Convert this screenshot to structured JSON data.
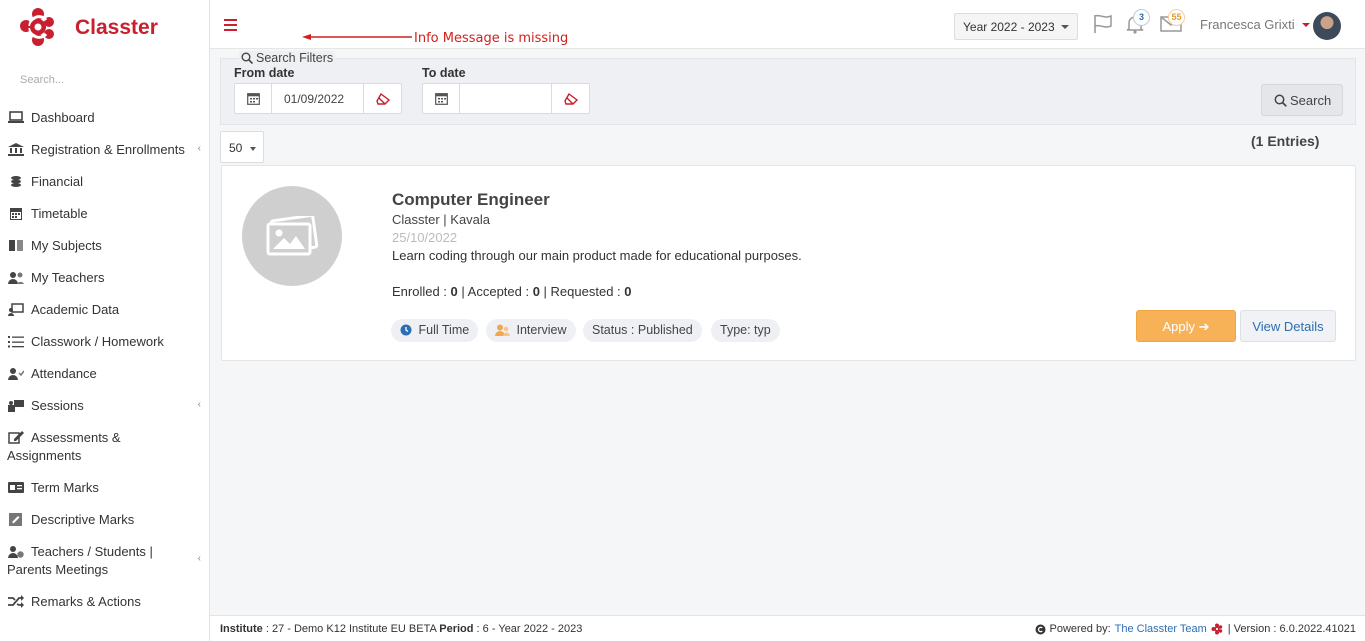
{
  "app": {
    "name": "Classter",
    "brand_color": "#c8202f"
  },
  "sidebar": {
    "search_placeholder": "Search...",
    "items": [
      {
        "label": "Dashboard",
        "icon": "laptop-icon"
      },
      {
        "label": "Registration & Enrollments",
        "icon": "bank-icon",
        "expandable": true
      },
      {
        "label": "Financial",
        "icon": "coins-icon"
      },
      {
        "label": "Timetable",
        "icon": "calendar-icon"
      },
      {
        "label": "My Subjects",
        "icon": "book-icon"
      },
      {
        "label": "My Teachers",
        "icon": "users-icon"
      },
      {
        "label": "Academic Data",
        "icon": "chalkboard-icon"
      },
      {
        "label": "Classwork / Homework",
        "icon": "tasks-icon"
      },
      {
        "label": "Attendance",
        "icon": "user-check-icon"
      },
      {
        "label": "Sessions",
        "icon": "sessions-icon",
        "expandable": true
      },
      {
        "label": "Assessments & Assignments",
        "icon": "edit-icon"
      },
      {
        "label": "Term Marks",
        "icon": "id-card-icon"
      },
      {
        "label": "Descriptive Marks",
        "icon": "note-icon"
      },
      {
        "label": "Teachers / Students | Parents Meetings",
        "icon": "meeting-icon",
        "expandable": true
      },
      {
        "label": "Remarks & Actions",
        "icon": "shuffle-icon"
      }
    ]
  },
  "header": {
    "annotation": "Info Message is missing",
    "year_selector": "Year 2022 - 2023",
    "notifications_count": "3",
    "messages_count": "55",
    "user_name": "Francesca Grixti"
  },
  "filters": {
    "legend": "Search Filters",
    "from_label": "From date",
    "from_value": "01/09/2022",
    "to_label": "To date",
    "to_value": "",
    "search_label": "Search"
  },
  "list": {
    "page_size": "50",
    "entries": "(1 Entries)"
  },
  "job": {
    "title": "Computer Engineer",
    "org": "Classter | Kavala",
    "date": "25/10/2022",
    "description": "Learn coding through our main product made for educational purposes.",
    "enrolled_label": "Enrolled : ",
    "enrolled": "0",
    "accepted_label": " | Accepted : ",
    "accepted": "0",
    "requested_label": " | Requested : ",
    "requested": "0",
    "tags": {
      "full_time": "Full Time",
      "interview": "Interview",
      "status": "Status : Published",
      "type": "Type: typ"
    },
    "apply_label": "Apply ➔",
    "details_label": "View Details"
  },
  "footer": {
    "institute_label": "Institute",
    "institute_value": " : 27 - Demo K12 Institute EU BETA ",
    "period_label": "Period",
    "period_value": " : 6 - Year 2022 - 2023",
    "powered_by": "Powered by:",
    "team": "The Classter Team",
    "version": "| Version : 6.0.2022.41021"
  }
}
